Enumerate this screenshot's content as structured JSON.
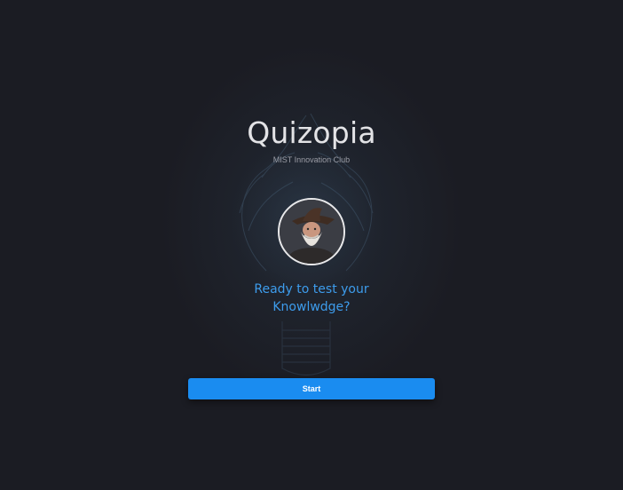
{
  "app": {
    "title": "Quizopia",
    "subtitle": "MIST Innovation Club"
  },
  "avatar": {
    "icon": "wizard-avatar-icon"
  },
  "prompt": {
    "line1": "Ready to test your",
    "line2": "Knowlwdge?"
  },
  "actions": {
    "start_label": "Start"
  },
  "colors": {
    "background": "#1b1c23",
    "title": "#e3e3e6",
    "prompt": "#3d9cec",
    "button": "#1a8cf0"
  }
}
